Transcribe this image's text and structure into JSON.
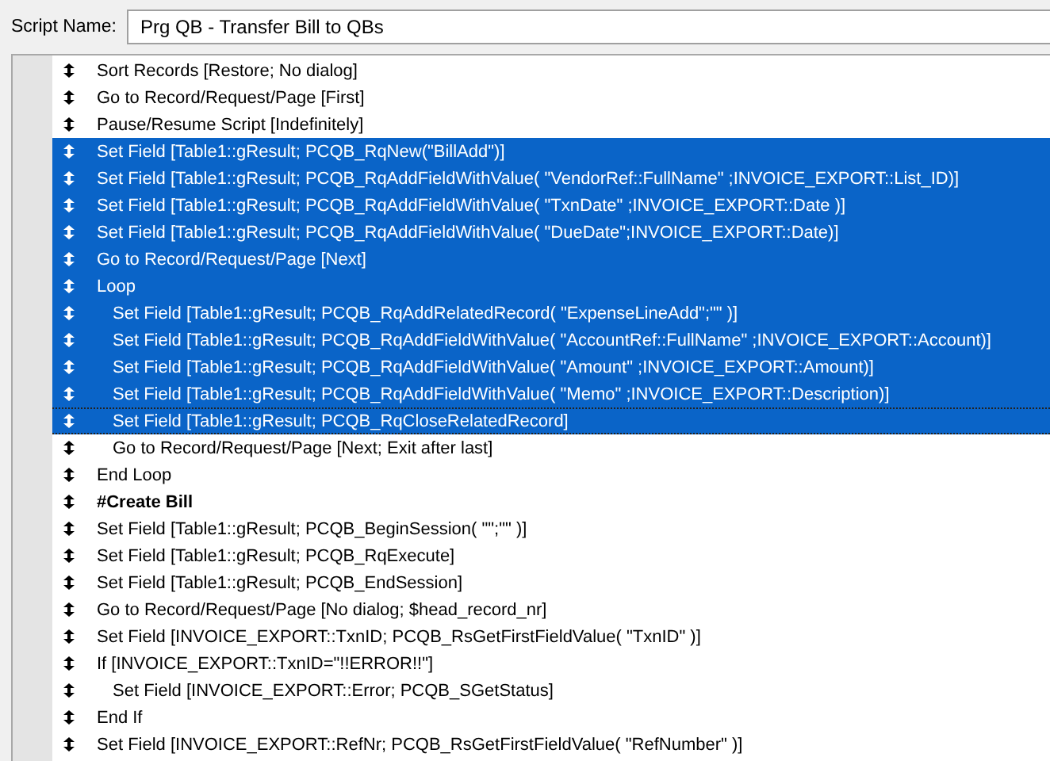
{
  "script_name": {
    "label": "Script Name:",
    "value": "Prg QB - Transfer Bill to QBs"
  },
  "steps": [
    {
      "kind": "step",
      "text": "Sort Records [Restore; No dialog]",
      "selected": false,
      "focused": false
    },
    {
      "kind": "step",
      "text": "Go to Record/Request/Page [First]",
      "selected": false,
      "focused": false
    },
    {
      "kind": "step",
      "text": "Pause/Resume Script [Indefinitely]",
      "selected": false,
      "focused": false
    },
    {
      "kind": "step",
      "text": "Set Field [Table1::gResult; PCQB_RqNew(\"BillAdd\")]",
      "selected": true,
      "focused": false
    },
    {
      "kind": "step",
      "text": "Set Field [Table1::gResult; PCQB_RqAddFieldWithValue( \"VendorRef::FullName\" ;INVOICE_EXPORT::List_ID)]",
      "selected": true,
      "focused": false
    },
    {
      "kind": "step",
      "text": "Set Field [Table1::gResult; PCQB_RqAddFieldWithValue( \"TxnDate\" ;INVOICE_EXPORT::Date )]",
      "selected": true,
      "focused": false
    },
    {
      "kind": "step",
      "text": "Set Field [Table1::gResult; PCQB_RqAddFieldWithValue( \"DueDate\";INVOICE_EXPORT::Date)]",
      "selected": true,
      "focused": false
    },
    {
      "kind": "step",
      "text": "Go to Record/Request/Page [Next]",
      "selected": true,
      "focused": false
    },
    {
      "kind": "step",
      "text": "Loop",
      "selected": true,
      "focused": false,
      "children": [
        {
          "kind": "step",
          "text": "Set Field [Table1::gResult; PCQB_RqAddRelatedRecord( \"ExpenseLineAdd\";\"\" )]",
          "selected": true,
          "focused": false
        },
        {
          "kind": "step",
          "text": "Set Field [Table1::gResult; PCQB_RqAddFieldWithValue( \"AccountRef::FullName\" ;INVOICE_EXPORT::Account)]",
          "selected": true,
          "focused": false
        },
        {
          "kind": "step",
          "text": "Set Field [Table1::gResult; PCQB_RqAddFieldWithValue( \"Amount\" ;INVOICE_EXPORT::Amount)]",
          "selected": true,
          "focused": false
        },
        {
          "kind": "step",
          "text": "Set Field [Table1::gResult; PCQB_RqAddFieldWithValue( \"Memo\" ;INVOICE_EXPORT::Description)]",
          "selected": true,
          "focused": false
        },
        {
          "kind": "step",
          "text": "Set Field [Table1::gResult; PCQB_RqCloseRelatedRecord]",
          "selected": true,
          "focused": true
        },
        {
          "kind": "step",
          "text": "Go to Record/Request/Page [Next; Exit after last]",
          "selected": false,
          "focused": false
        }
      ]
    },
    {
      "kind": "step",
      "text": "End Loop",
      "selected": false,
      "focused": false
    },
    {
      "kind": "comment",
      "text": "#Create Bill",
      "selected": false,
      "focused": false
    },
    {
      "kind": "step",
      "text": "Set Field [Table1::gResult; PCQB_BeginSession( \"\";\"\" )]",
      "selected": false,
      "focused": false
    },
    {
      "kind": "step",
      "text": "Set Field [Table1::gResult; PCQB_RqExecute]",
      "selected": false,
      "focused": false
    },
    {
      "kind": "step",
      "text": "Set Field [Table1::gResult; PCQB_EndSession]",
      "selected": false,
      "focused": false
    },
    {
      "kind": "step",
      "text": "Go to Record/Request/Page [No dialog; $head_record_nr]",
      "selected": false,
      "focused": false
    },
    {
      "kind": "step",
      "text": "Set Field [INVOICE_EXPORT::TxnID; PCQB_RsGetFirstFieldValue( \"TxnID\" )]",
      "selected": false,
      "focused": false
    },
    {
      "kind": "step",
      "text": "If [INVOICE_EXPORT::TxnID=\"!!ERROR!!\"]",
      "selected": false,
      "focused": false,
      "children": [
        {
          "kind": "step",
          "text": "Set Field [INVOICE_EXPORT::Error; PCQB_SGetStatus]",
          "selected": false,
          "focused": false
        }
      ]
    },
    {
      "kind": "step",
      "text": "End If",
      "selected": false,
      "focused": false
    },
    {
      "kind": "step",
      "text": "Set Field [INVOICE_EXPORT::RefNr; PCQB_RsGetFirstFieldValue( \"RefNumber\" )]",
      "selected": false,
      "focused": false
    }
  ]
}
